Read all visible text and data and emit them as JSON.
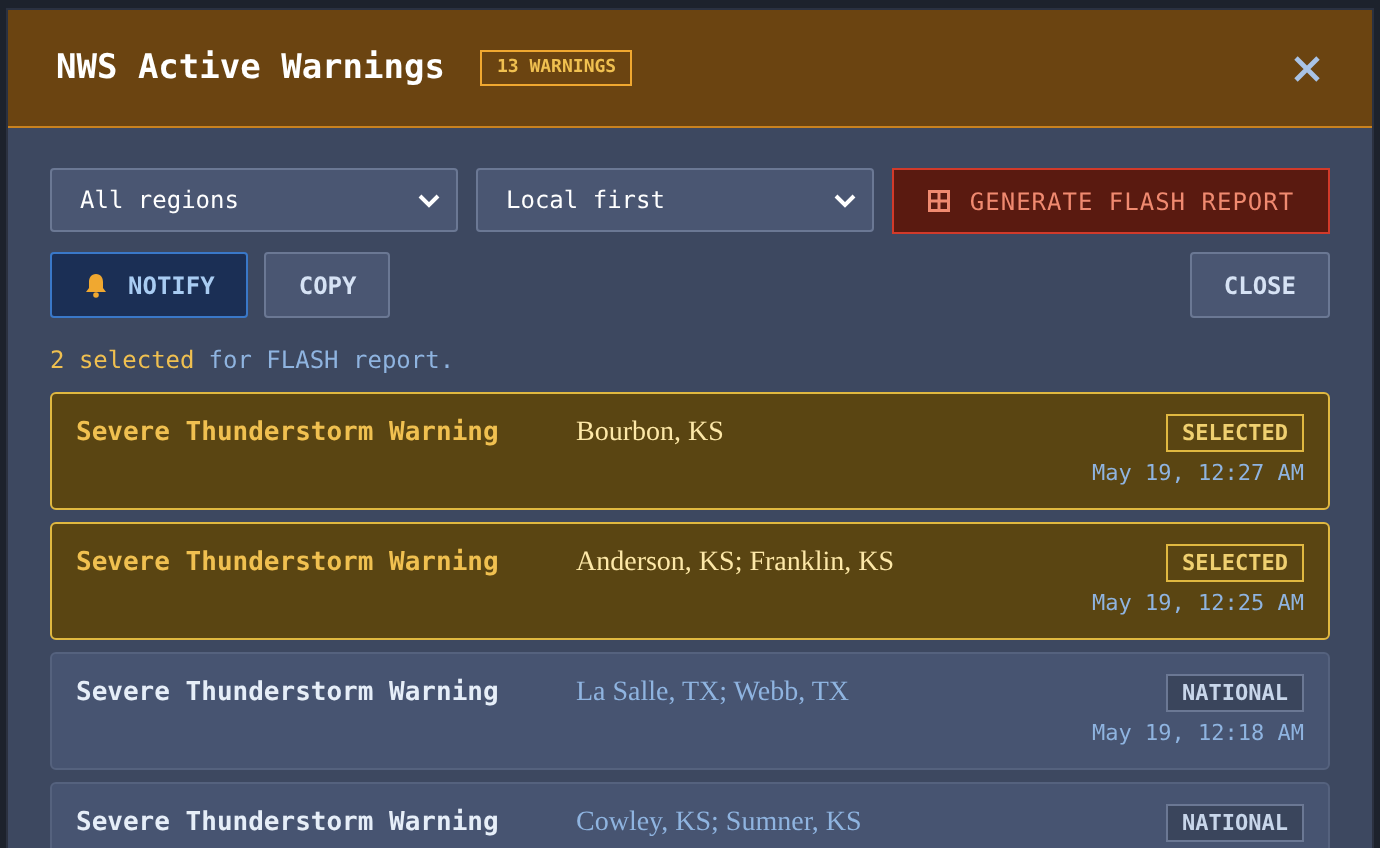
{
  "dialog": {
    "title": "NWS Active Warnings",
    "count_badge": "13 WARNINGS"
  },
  "filters": [
    {
      "value": "All regions"
    },
    {
      "value": "Local first"
    }
  ],
  "generate_button": {
    "label": "GENERATE FLASH REPORT"
  },
  "notify_button": {
    "label": "NOTIFY",
    "on": true
  },
  "copy_button": {
    "label": "COPY"
  },
  "close_button": {
    "label": "CLOSE"
  },
  "selection_status": {
    "count": "2 selected",
    "rest": "for FLASH report."
  },
  "warnings": [
    {
      "title": "Severe Thunderstorm Warning",
      "areas": "Bourbon, KS",
      "badge": "SELECTED",
      "time": "May 19, 12:27 AM",
      "selected": true
    },
    {
      "title": "Severe Thunderstorm Warning",
      "areas": "Anderson, KS; Franklin, KS",
      "badge": "SELECTED",
      "time": "May 19, 12:25 AM",
      "selected": true
    },
    {
      "title": "Severe Thunderstorm Warning",
      "areas": "La Salle, TX; Webb, TX",
      "badge": "NATIONAL",
      "time": "May 19, 12:18 AM",
      "selected": false
    },
    {
      "title": "Severe Thunderstorm Warning",
      "areas": "Cowley, KS; Sumner, KS",
      "badge": "NATIONAL",
      "selected": false
    }
  ]
}
